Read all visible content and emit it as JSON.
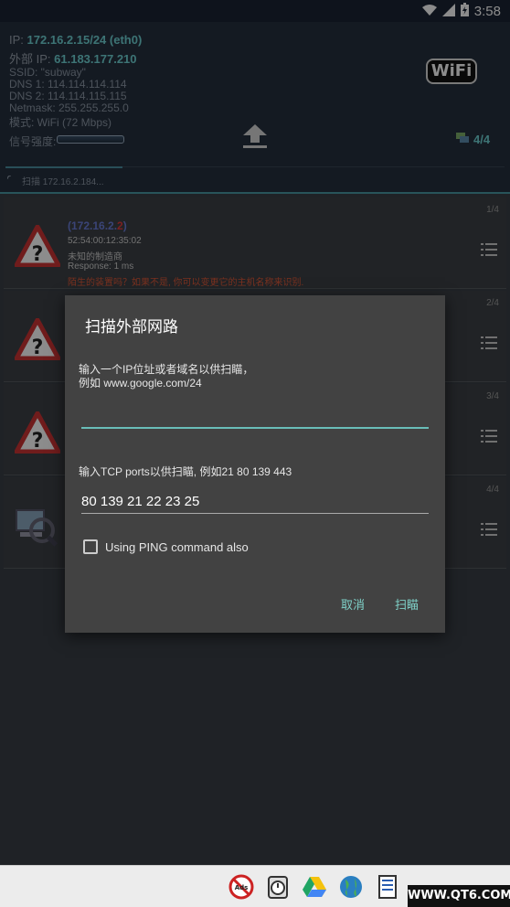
{
  "status_bar": {
    "time": "3:58"
  },
  "header": {
    "ip_label": "IP:",
    "ip_value": "172.16.2.15/24 (eth0)",
    "external_label": "外部 IP:",
    "external_value": "61.183.177.210",
    "ssid": "SSID: \"subway\"",
    "dns1": "DNS 1: 114.114.114.114",
    "dns2": "DNS 2: 114.114.115.115",
    "netmask": "Netmask: 255.255.255.0",
    "mode": "模式: WiFi (72 Mbps)",
    "signal_label": "信号强度:",
    "wifi_logo": "WiFi",
    "device_count": "4/4",
    "scan_status": "扫描 172.16.2.184..."
  },
  "list": {
    "rows": [
      {
        "index": "1/4",
        "ip_prefix": "(172.16.2.",
        "ip_last": "2",
        "ip_suffix": ")",
        "mac": "52:54:00:12:35:02",
        "vendor": "未知的制造商",
        "response": "Response: 1 ms",
        "warning": "陌生的装置吗？如果不是, 你可以变更它的主机名称来识别."
      },
      {
        "index": "2/4"
      },
      {
        "index": "3/4"
      },
      {
        "index": "4/4"
      }
    ]
  },
  "dialog": {
    "title": "扫描外部网路",
    "hint1": "输入一个IP位址或者域名以供扫瞄，\n例如 www.google.com/24",
    "input1_value": "",
    "hint2": "输入TCP ports以供扫瞄, 例如21 80 139 443",
    "input2_value": "80 139 21 22 23 25",
    "ping_label": "Using PING command also",
    "cancel_label": "取消",
    "scan_label": "扫瞄"
  },
  "watermark": "WWW.QT6.COM",
  "colors": {
    "accent": "#69bdb8",
    "ip_value": "#6fd3d6",
    "warning": "#e05a3a",
    "header_bg": "#25313f"
  }
}
